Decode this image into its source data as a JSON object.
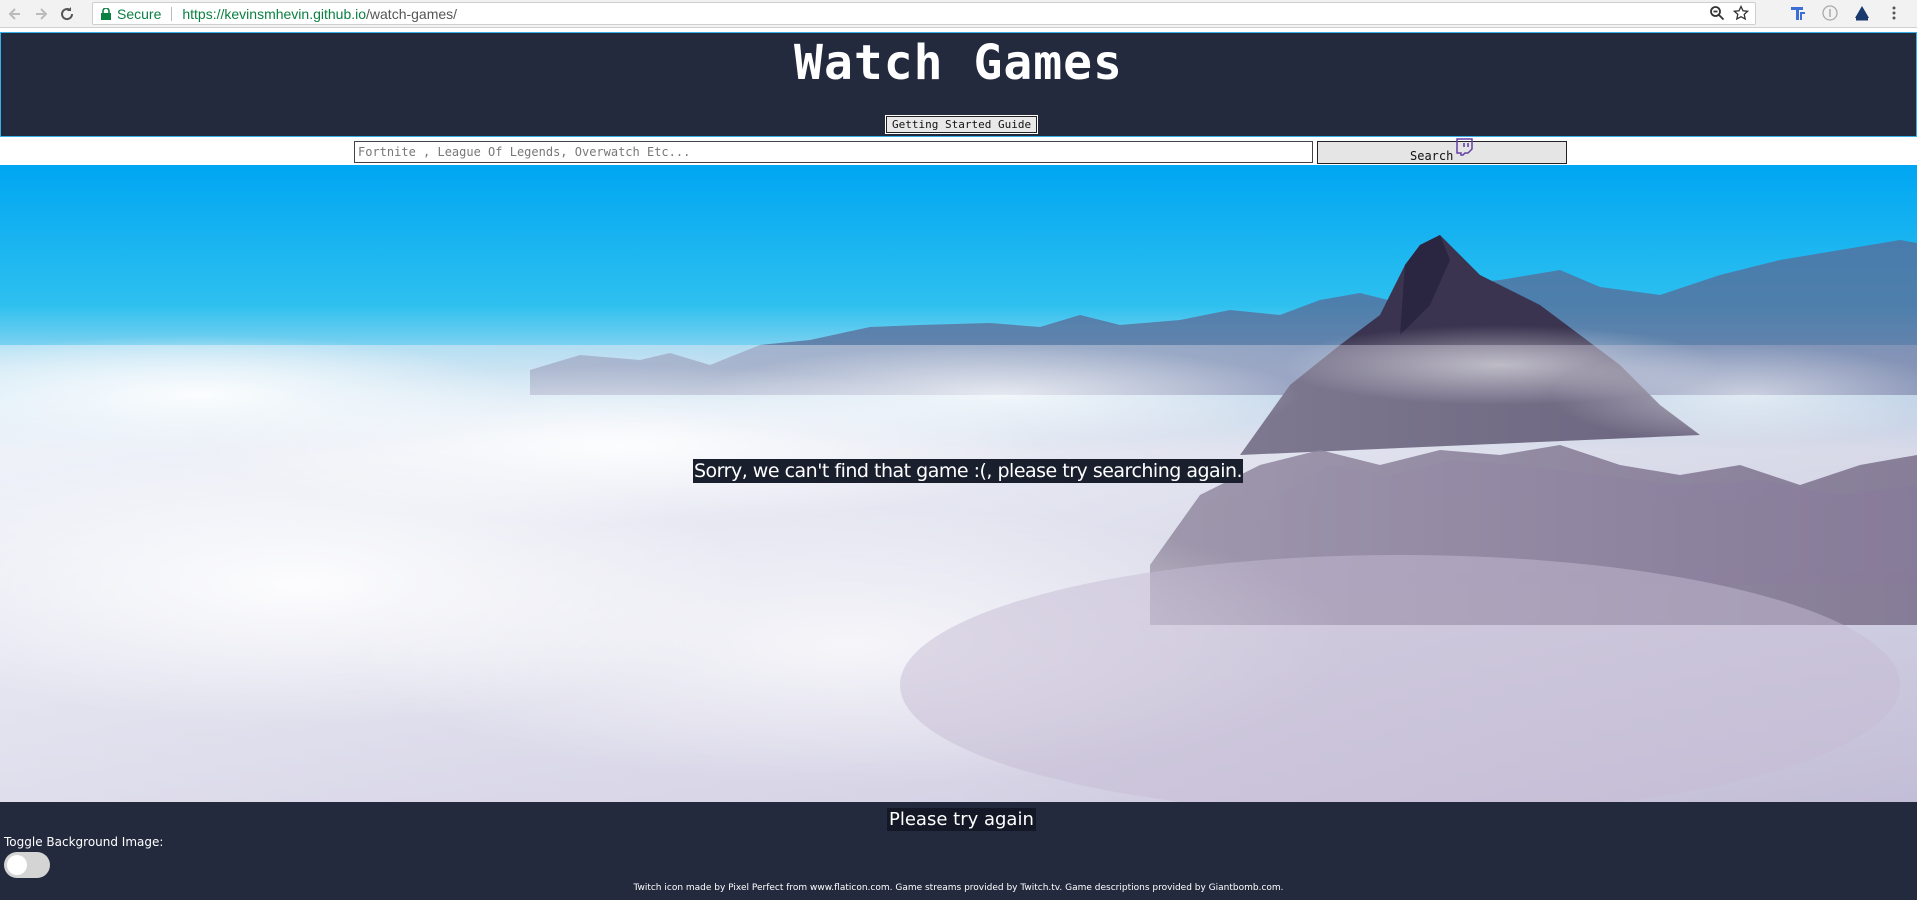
{
  "browser": {
    "secure_label": "Secure",
    "url_host": "https://kevinsmhevin.github.io",
    "url_path": "/watch-games/"
  },
  "header": {
    "title": "Watch Games",
    "guide_button": "Getting Started Guide"
  },
  "search": {
    "placeholder": "Fortnite , League Of Legends, Overwatch Etc...",
    "value": "",
    "button_label": "Search"
  },
  "main": {
    "message": "Sorry, we can't find that game :(, please try searching again."
  },
  "footer": {
    "try_again": "Please try again",
    "toggle_label": "Toggle Background Image:",
    "toggle_on": false,
    "credits": "Twitch icon made by Pixel Perfect from www.flaticon.com. Game streams provided by Twitch.tv. Game descriptions provided by Giantbomb.com."
  },
  "colors": {
    "header_bg": "#242a3e",
    "twitch_purple": "#6441a5",
    "secure_green": "#0b8043"
  },
  "icons": [
    "back-arrow-icon",
    "forward-arrow-icon",
    "reload-icon",
    "lock-icon",
    "zoom-icon",
    "star-icon",
    "twitch-icon",
    "extension-icon"
  ]
}
